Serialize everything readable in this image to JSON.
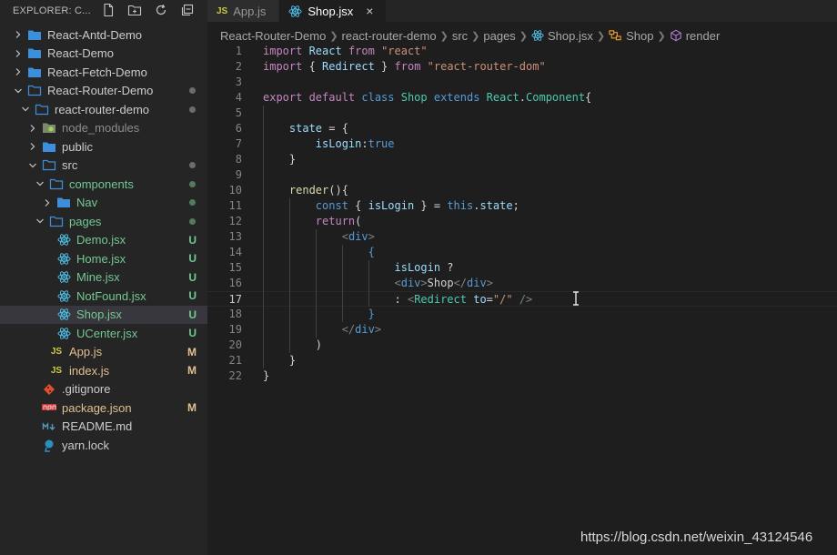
{
  "explorer": {
    "title": "EXPLORER: C...",
    "items": [
      {
        "label": "React-Antd-Demo",
        "depth": 0,
        "kind": "folder",
        "open": false
      },
      {
        "label": "React-Demo",
        "depth": 0,
        "kind": "folder",
        "open": false
      },
      {
        "label": "React-Fetch-Demo",
        "depth": 0,
        "kind": "folder",
        "open": false
      },
      {
        "label": "React-Router-Demo",
        "depth": 0,
        "kind": "folder",
        "open": true,
        "dot": "grey"
      },
      {
        "label": "react-router-demo",
        "depth": 1,
        "kind": "folder",
        "open": true,
        "dot": "grey"
      },
      {
        "label": "node_modules",
        "depth": 2,
        "kind": "node_modules",
        "open": false,
        "dim": true
      },
      {
        "label": "public",
        "depth": 2,
        "kind": "folder",
        "open": false
      },
      {
        "label": "src",
        "depth": 2,
        "kind": "folder",
        "open": true,
        "dot": "grey"
      },
      {
        "label": "components",
        "depth": 3,
        "kind": "folder",
        "open": true,
        "color": "u",
        "dot": "green"
      },
      {
        "label": "Nav",
        "depth": 4,
        "kind": "folder",
        "open": false,
        "color": "u",
        "dot": "green"
      },
      {
        "label": "pages",
        "depth": 3,
        "kind": "folder",
        "open": true,
        "color": "u",
        "dot": "green"
      },
      {
        "label": "Demo.jsx",
        "depth": 4,
        "kind": "react",
        "color": "u",
        "badge": "U"
      },
      {
        "label": "Home.jsx",
        "depth": 4,
        "kind": "react",
        "color": "u",
        "badge": "U"
      },
      {
        "label": "Mine.jsx",
        "depth": 4,
        "kind": "react",
        "color": "u",
        "badge": "U"
      },
      {
        "label": "NotFound.jsx",
        "depth": 4,
        "kind": "react",
        "color": "u",
        "badge": "U"
      },
      {
        "label": "Shop.jsx",
        "depth": 4,
        "kind": "react",
        "color": "u",
        "badge": "U",
        "selected": true
      },
      {
        "label": "UCenter.jsx",
        "depth": 4,
        "kind": "react",
        "color": "u",
        "badge": "U"
      },
      {
        "label": "App.js",
        "depth": 3,
        "kind": "js",
        "color": "m",
        "badge": "M"
      },
      {
        "label": "index.js",
        "depth": 3,
        "kind": "js",
        "color": "m",
        "badge": "M"
      },
      {
        "label": ".gitignore",
        "depth": 2,
        "kind": "git"
      },
      {
        "label": "package.json",
        "depth": 2,
        "kind": "npm",
        "color": "m",
        "badge": "M"
      },
      {
        "label": "README.md",
        "depth": 2,
        "kind": "md"
      },
      {
        "label": "yarn.lock",
        "depth": 2,
        "kind": "yarn"
      }
    ]
  },
  "tabs": [
    {
      "label": "App.js",
      "icon": "JS",
      "active": false
    },
    {
      "label": "Shop.jsx",
      "icon": "react-icon",
      "active": true,
      "close": "×"
    }
  ],
  "breadcrumb": {
    "parts": [
      "React-Router-Demo",
      "react-router-demo",
      "src",
      "pages",
      "Shop.jsx",
      "Shop",
      "render"
    ]
  },
  "editor": {
    "current_line": 17,
    "lines": [
      [
        [
          "kw",
          "import "
        ],
        [
          "va",
          "React "
        ],
        [
          "kw",
          "from "
        ],
        [
          "st",
          "\"react\""
        ]
      ],
      [
        [
          "kw",
          "import "
        ],
        [
          "",
          "{ "
        ],
        [
          "va",
          "Redirect"
        ],
        [
          "",
          " } "
        ],
        [
          "kw",
          "from "
        ],
        [
          "st",
          "\"react-router-dom\""
        ]
      ],
      [],
      [
        [
          "kw",
          "export "
        ],
        [
          "kw",
          "default "
        ],
        [
          "bl",
          "class "
        ],
        [
          "ty",
          "Shop "
        ],
        [
          "bl",
          "extends "
        ],
        [
          "ty",
          "React"
        ],
        [
          "",
          "."
        ],
        [
          "ty",
          "Component"
        ],
        [
          "",
          "{"
        ]
      ],
      [],
      [
        [
          "",
          "    "
        ],
        [
          "va",
          "state"
        ],
        [
          "",
          " = {"
        ]
      ],
      [
        [
          "",
          "        "
        ],
        [
          "va",
          "isLogin"
        ],
        [
          "",
          ":"
        ],
        [
          "bl",
          "true"
        ]
      ],
      [
        [
          "",
          "    }"
        ]
      ],
      [],
      [
        [
          "",
          "    "
        ],
        [
          "fn",
          "render"
        ],
        [
          "",
          "(){"
        ]
      ],
      [
        [
          "",
          "        "
        ],
        [
          "bl",
          "const "
        ],
        [
          "",
          "{ "
        ],
        [
          "va",
          "isLogin"
        ],
        [
          "",
          " } = "
        ],
        [
          "bl",
          "this"
        ],
        [
          "",
          "."
        ],
        [
          "va",
          "state"
        ],
        [
          "",
          ";"
        ]
      ],
      [
        [
          "",
          "        "
        ],
        [
          "kw",
          "return"
        ],
        [
          "",
          "("
        ]
      ],
      [
        [
          "",
          "            "
        ],
        [
          "ang",
          "<"
        ],
        [
          "tg",
          "div"
        ],
        [
          "ang",
          ">"
        ]
      ],
      [
        [
          "",
          "                "
        ],
        [
          "bl",
          "{"
        ]
      ],
      [
        [
          "",
          "                    "
        ],
        [
          "va",
          "isLogin"
        ],
        [
          "",
          " ?"
        ]
      ],
      [
        [
          "",
          "                    "
        ],
        [
          "ang",
          "<"
        ],
        [
          "tg",
          "div"
        ],
        [
          "ang",
          ">"
        ],
        [
          "",
          "Shop"
        ],
        [
          "ang",
          "</"
        ],
        [
          "tg",
          "div"
        ],
        [
          "ang",
          ">"
        ]
      ],
      [
        [
          "",
          "                    : "
        ],
        [
          "ang",
          "<"
        ],
        [
          "ty",
          "Redirect "
        ],
        [
          "va",
          "to"
        ],
        [
          "",
          "="
        ],
        [
          "st",
          "\"/\" "
        ],
        [
          "ang",
          "/>"
        ]
      ],
      [
        [
          "",
          "                "
        ],
        [
          "bl",
          "}"
        ]
      ],
      [
        [
          "",
          "            "
        ],
        [
          "ang",
          "</"
        ],
        [
          "tg",
          "div"
        ],
        [
          "ang",
          ">"
        ]
      ],
      [
        [
          "",
          "        )"
        ]
      ],
      [
        [
          "",
          "    }"
        ]
      ],
      [
        [
          "",
          "}"
        ]
      ]
    ]
  },
  "watermark": "https://blog.csdn.net/weixin_43124546"
}
